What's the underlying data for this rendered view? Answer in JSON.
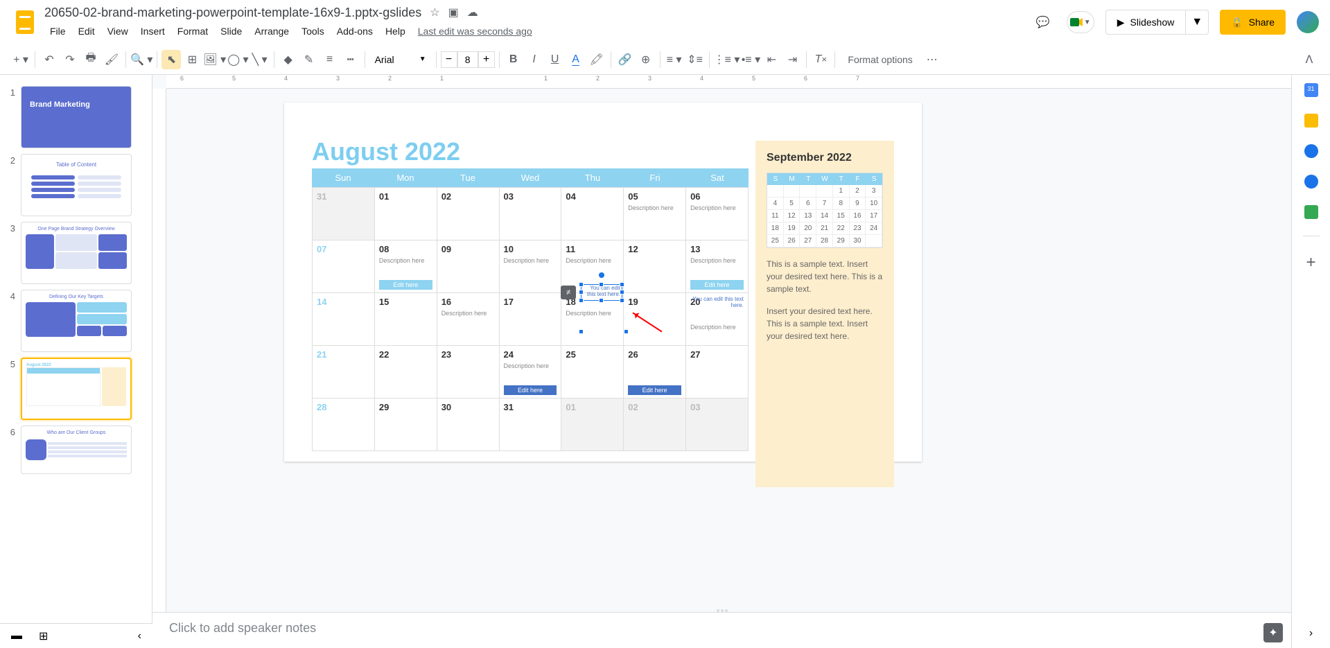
{
  "doc_title": "20650-02-brand-marketing-powerpoint-template-16x9-1.pptx-gslides",
  "menu": {
    "file": "File",
    "edit": "Edit",
    "view": "View",
    "insert": "Insert",
    "format": "Format",
    "slide": "Slide",
    "arrange": "Arrange",
    "tools": "Tools",
    "addons": "Add-ons",
    "help": "Help",
    "last_edit": "Last edit was seconds ago"
  },
  "header": {
    "slideshow": "Slideshow",
    "share": "Share"
  },
  "toolbar": {
    "font": "Arial",
    "font_size": "8",
    "format_options": "Format options"
  },
  "thumb1": "Brand Marketing",
  "thumb2": "Table of Content",
  "thumb3": "One Page Brand Strategy Overview",
  "thumb4": "Defining Our Key Targets",
  "thumb6": "Who are Our Client Groups",
  "calendar": {
    "title": "August 2022",
    "days": [
      "Sun",
      "Mon",
      "Tue",
      "Wed",
      "Thu",
      "Fri",
      "Sat"
    ],
    "desc": "Description here",
    "edit_here": "Edit here",
    "edit_note": "You can edit this text here."
  },
  "sidebar": {
    "title": "September 2022",
    "days": [
      "S",
      "M",
      "T",
      "W",
      "T",
      "F",
      "S"
    ],
    "text1": "This is a sample text. Insert your desired text here. This is a sample text.",
    "text2": "Insert your desired text here. This is a sample text. Insert your desired text here."
  },
  "speaker": "Click to add speaker notes",
  "chart_data": {
    "type": "table",
    "title": "August 2022 calendar",
    "columns": [
      "Sun",
      "Mon",
      "Tue",
      "Wed",
      "Thu",
      "Fri",
      "Sat"
    ],
    "rows": [
      [
        "31",
        "01",
        "02",
        "03",
        "04",
        "05",
        "06"
      ],
      [
        "07",
        "08",
        "09",
        "10",
        "11",
        "12",
        "13"
      ],
      [
        "14",
        "15",
        "16",
        "17",
        "18",
        "19",
        "20"
      ],
      [
        "21",
        "22",
        "23",
        "24",
        "25",
        "26",
        "27"
      ],
      [
        "28",
        "29",
        "30",
        "31",
        "01",
        "02",
        "03"
      ]
    ],
    "mini_calendar": {
      "title": "September 2022",
      "columns": [
        "S",
        "M",
        "T",
        "W",
        "T",
        "F",
        "S"
      ],
      "rows": [
        [
          "",
          "",
          "",
          "",
          "1",
          "2",
          "3"
        ],
        [
          "4",
          "5",
          "6",
          "7",
          "8",
          "9",
          "10"
        ],
        [
          "11",
          "12",
          "13",
          "14",
          "15",
          "16",
          "17"
        ],
        [
          "18",
          "19",
          "20",
          "21",
          "22",
          "23",
          "24"
        ],
        [
          "25",
          "26",
          "27",
          "28",
          "29",
          "30",
          ""
        ]
      ]
    }
  }
}
